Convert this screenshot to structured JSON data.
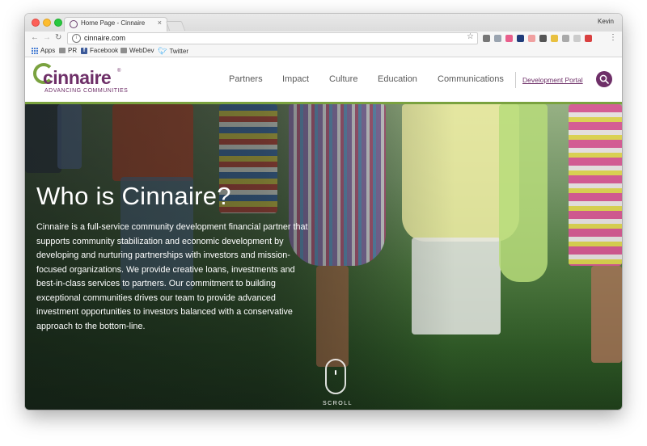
{
  "browser": {
    "tab_title": "Home Page - Cinnaire",
    "tab_close": "×",
    "user": "Kevin",
    "url": "cinnaire.com",
    "nav": {
      "back": "←",
      "forward": "→",
      "reload": "↻"
    },
    "star": "☆",
    "menu": "⋮",
    "bookmarks": [
      {
        "label": "Apps",
        "icon": "apps-grid-icon"
      },
      {
        "label": "PR",
        "icon": "folder-icon"
      },
      {
        "label": "Facebook",
        "icon": "facebook-icon"
      },
      {
        "label": "WebDev",
        "icon": "folder-icon"
      },
      {
        "label": "Twitter",
        "icon": "twitter-icon"
      }
    ],
    "extension_colors": [
      "#777777",
      "#9aa4b0",
      "#e85f8c",
      "#1f3b7a",
      "#f0a0a0",
      "#555555",
      "#e8c040",
      "#aaaaaa",
      "#cccccc",
      "#d94040"
    ]
  },
  "site": {
    "logo": {
      "name": "cinnaire",
      "registered": "®",
      "tagline": "ADVANCING COMMUNITIES"
    },
    "nav": [
      {
        "label": "Partners"
      },
      {
        "label": "Impact"
      },
      {
        "label": "Culture"
      },
      {
        "label": "Education"
      },
      {
        "label": "Communications"
      }
    ],
    "portal_link": "Development Portal",
    "colors": {
      "brand_purple": "#6e2f68",
      "brand_green": "#7aa23f"
    },
    "hero": {
      "title": "Who is Cinnaire?",
      "body": "Cinnaire is a full-service community development financial partner that supports community stabilization and economic development by developing and nurturing partnerships with investors and mission-focused organizations. We provide creative loans, investments and best-in-class services to partners. Our commitment to building exceptional communities drives our team to provide advanced investment opportunities to investors balanced with a conservative approach to the bottom-line.",
      "scroll_label": "SCROLL"
    }
  }
}
